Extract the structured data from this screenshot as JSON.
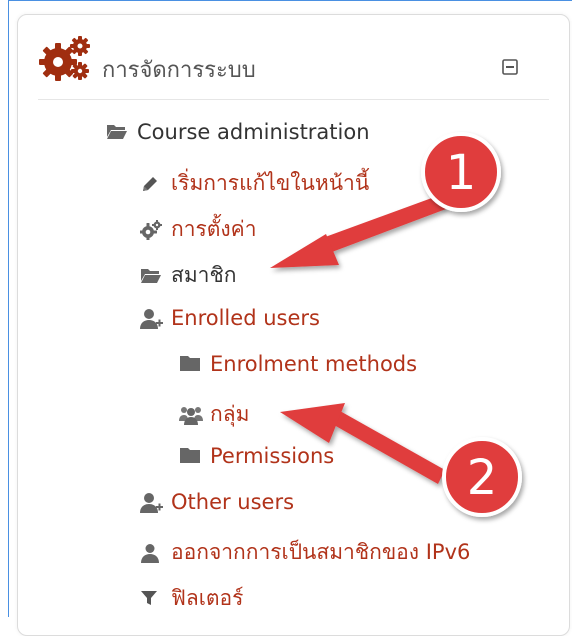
{
  "block": {
    "title": "การจัดการระบบ",
    "gear_icon": "gears-icon",
    "collapse_icon": "minus-square-icon"
  },
  "tree": {
    "course_admin": "Course administration",
    "edit_page": "เริ่มการแก้ไขในหน้านี้",
    "settings": "การตั้งค่า",
    "users": "สมาชิก",
    "enrolled_users": "Enrolled users",
    "enrolment_methods": "Enrolment methods",
    "groups": "กลุ่ม",
    "permissions": "Permissions",
    "other_users": "Other users",
    "unenrol": "ออกจากการเป็นสมาชิกของ IPv6",
    "filters": "ฟิลเตอร์"
  },
  "annotations": {
    "badge_1": "1",
    "badge_2": "2"
  },
  "colors": {
    "link": "#b1331a",
    "icon": "#555555",
    "gear": "#a02e10",
    "badge": "#e03c3c",
    "arrow": "#e03c3c"
  }
}
